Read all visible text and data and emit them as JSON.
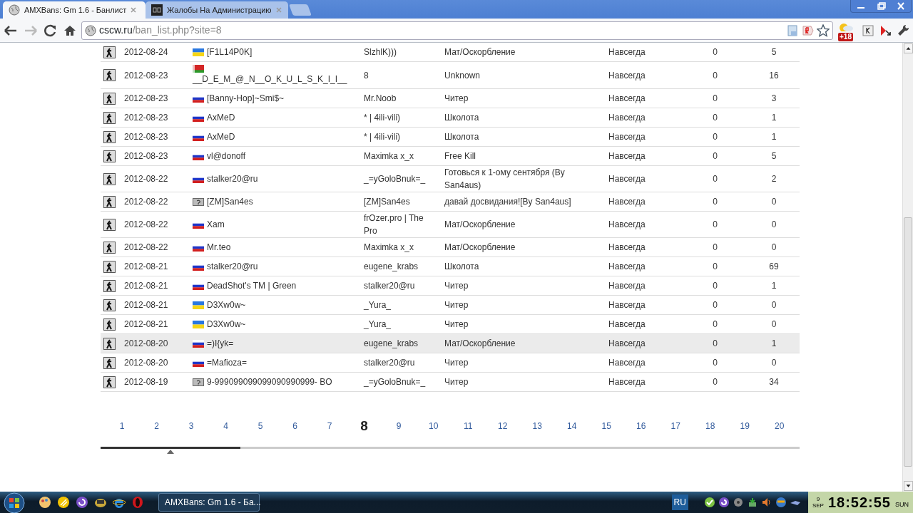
{
  "browser": {
    "tabs": [
      {
        "title": "AMXBans: Gm 1.6 - Банлист",
        "selected": true
      },
      {
        "title": "Жалобы На Администрацию",
        "selected": false
      }
    ],
    "address": {
      "host": "cscw.ru",
      "path": "/ban_list.php?site=8"
    },
    "badge": "+18"
  },
  "table": {
    "rows": [
      {
        "date": "2012-08-24",
        "kind": "ua",
        "player": "[F1L14P0K]",
        "admin": "SlzhlK)))",
        "reason": "Мат/Оскорбление",
        "length": "Навсегда",
        "column_7": "0",
        "column_8": "5",
        "highlighted": false
      },
      {
        "date": "2012-08-23",
        "kind": "by",
        "player": "__D_E_M_@_N__O_K_U_L_S_K_I_I__",
        "admin": "8",
        "reason": "Unknown",
        "length": "Навсегда",
        "column_7": "0",
        "column_8": "16",
        "highlighted": false
      },
      {
        "date": "2012-08-23",
        "kind": "ru",
        "player": "[Banny-Hop]~Smi$~",
        "admin": "Mr.Noob",
        "reason": "Читер",
        "length": "Навсегда",
        "column_7": "0",
        "column_8": "3",
        "highlighted": false
      },
      {
        "date": "2012-08-23",
        "kind": "ru",
        "player": "AxMeD",
        "admin": "* | 4ili-vili)",
        "reason": "Школота",
        "length": "Навсегда",
        "column_7": "0",
        "column_8": "1",
        "highlighted": false
      },
      {
        "date": "2012-08-23",
        "kind": "ru",
        "player": "AxMeD",
        "admin": "* | 4ili-vili)",
        "reason": "Школота",
        "length": "Навсегда",
        "column_7": "0",
        "column_8": "1",
        "highlighted": false
      },
      {
        "date": "2012-08-23",
        "kind": "ru",
        "player": "vl@donoff",
        "admin": "Maximka x_x",
        "reason": "Free Kill",
        "length": "Навсегда",
        "column_7": "0",
        "column_8": "5",
        "highlighted": false
      },
      {
        "date": "2012-08-22",
        "kind": "ru",
        "player": "stalker20@ru",
        "admin": "_=yGoloBnuk=_",
        "reason": "Готовься к 1-ому сентября (By San4aus)",
        "length": "Навсегда",
        "column_7": "0",
        "column_8": "2",
        "highlighted": false
      },
      {
        "date": "2012-08-22",
        "kind": "unknown",
        "player": "[ZM]San4es",
        "admin": "[ZM]San4es",
        "reason": "давай досвидания![By San4aus]",
        "length": "Навсегда",
        "column_7": "0",
        "column_8": "0",
        "highlighted": false
      },
      {
        "date": "2012-08-22",
        "kind": "ru",
        "player": "Xam",
        "admin": "frOzer.pro | The Pro",
        "reason": "Мат/Оскорбление",
        "length": "Навсегда",
        "column_7": "0",
        "column_8": "0",
        "highlighted": false
      },
      {
        "date": "2012-08-22",
        "kind": "ru",
        "player": "Mr.teo",
        "admin": "Maximka x_x",
        "reason": "Мат/Оскорбление",
        "length": "Навсегда",
        "column_7": "0",
        "column_8": "0",
        "highlighted": false
      },
      {
        "date": "2012-08-21",
        "kind": "ru",
        "player": "stalker20@ru",
        "admin": "eugene_krabs",
        "reason": "Школота",
        "length": "Навсегда",
        "column_7": "0",
        "column_8": "69",
        "highlighted": false
      },
      {
        "date": "2012-08-21",
        "kind": "ru",
        "player": "DeadShot's TM | Green",
        "admin": "stalker20@ru",
        "reason": "Читер",
        "length": "Навсегда",
        "column_7": "0",
        "column_8": "1",
        "highlighted": false
      },
      {
        "date": "2012-08-21",
        "kind": "ua",
        "player": "D3Xw0w~",
        "admin": "_Yura_",
        "reason": "Читер",
        "length": "Навсегда",
        "column_7": "0",
        "column_8": "0",
        "highlighted": false
      },
      {
        "date": "2012-08-21",
        "kind": "ua",
        "player": "D3Xw0w~",
        "admin": "_Yura_",
        "reason": "Читер",
        "length": "Навсегда",
        "column_7": "0",
        "column_8": "0",
        "highlighted": false
      },
      {
        "date": "2012-08-20",
        "kind": "ru",
        "player": "=)I{yk=",
        "admin": "eugene_krabs",
        "reason": "Мат/Оскорбление",
        "length": "Навсегда",
        "column_7": "0",
        "column_8": "1",
        "highlighted": true
      },
      {
        "date": "2012-08-20",
        "kind": "ru",
        "player": "=Mafioza=",
        "admin": "stalker20@ru",
        "reason": "Читер",
        "length": "Навсегда",
        "column_7": "0",
        "column_8": "0",
        "highlighted": false
      },
      {
        "date": "2012-08-19",
        "kind": "unknown",
        "player": "9-999099099099090990999- BO",
        "admin": "_=yGoloBnuk=_",
        "reason": "Читер",
        "length": "Навсегда",
        "column_7": "0",
        "column_8": "34",
        "highlighted": false
      }
    ]
  },
  "pagination": {
    "pages": [
      {
        "label": "1",
        "selected": false
      },
      {
        "label": "2",
        "selected": false
      },
      {
        "label": "3",
        "selected": false
      },
      {
        "label": "4",
        "selected": false
      },
      {
        "label": "5",
        "selected": false
      },
      {
        "label": "6",
        "selected": false
      },
      {
        "label": "7",
        "selected": false
      },
      {
        "label": "8",
        "selected": true
      },
      {
        "label": "9",
        "selected": false
      },
      {
        "label": "10",
        "selected": false
      },
      {
        "label": "11",
        "selected": false
      },
      {
        "label": "12",
        "selected": false
      },
      {
        "label": "13",
        "selected": false
      },
      {
        "label": "14",
        "selected": false
      },
      {
        "label": "15",
        "selected": false
      },
      {
        "label": "16",
        "selected": false
      },
      {
        "label": "17",
        "selected": false
      },
      {
        "label": "18",
        "selected": false
      },
      {
        "label": "19",
        "selected": false
      },
      {
        "label": "20",
        "selected": false
      }
    ],
    "slider": {
      "level": 0.2
    }
  },
  "taskbar": {
    "task": "AMXBans: Gm 1.6 - Ба...",
    "language": "RU",
    "clock": {
      "day": "9",
      "month": "SEP",
      "time": "18:52:55",
      "weekday": "SUN"
    }
  }
}
